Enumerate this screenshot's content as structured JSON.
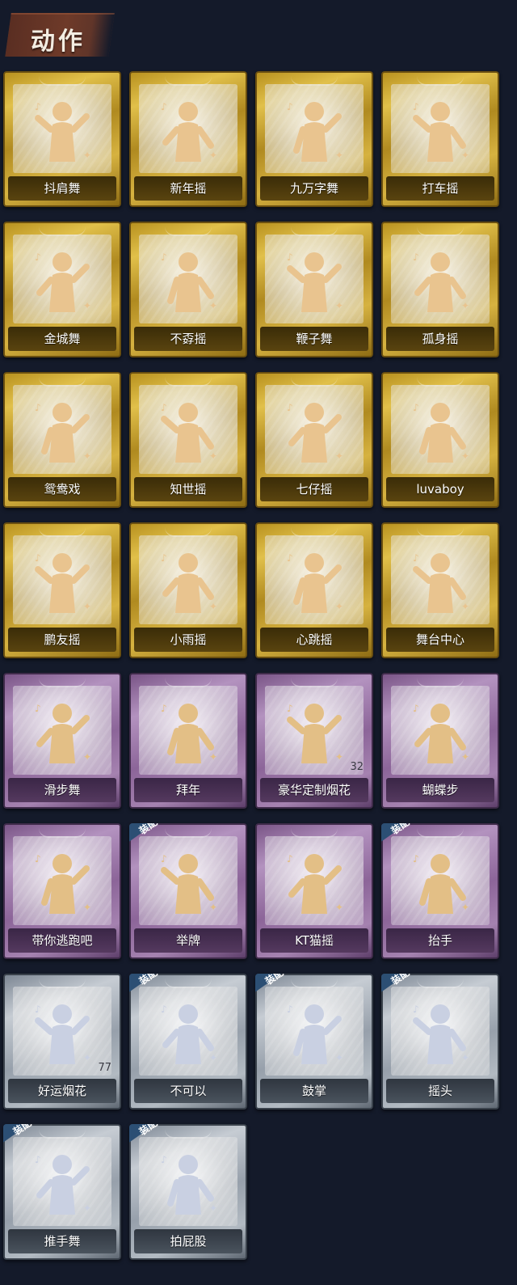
{
  "section": {
    "title": "动作"
  },
  "colors": {
    "gold": "#d6b240",
    "purple": "#a582b0",
    "silver": "#b2bac2",
    "badge": "#2c4f74",
    "background": "#141a2a"
  },
  "items": [
    {
      "label": "抖肩舞",
      "rarity": "gold",
      "icon": "shoulder-dance-icon"
    },
    {
      "label": "新年摇",
      "rarity": "gold",
      "icon": "new-year-dance-icon"
    },
    {
      "label": "九万字舞",
      "rarity": "gold",
      "icon": "swirl-dance-icon"
    },
    {
      "label": "打车摇",
      "rarity": "gold",
      "icon": "taxi-dance-icon"
    },
    {
      "label": "金城舞",
      "rarity": "gold",
      "icon": "wave-dance-icon"
    },
    {
      "label": "不孬摇",
      "rarity": "gold",
      "icon": "raised-arm-dance-icon"
    },
    {
      "label": "鞭子舞",
      "rarity": "gold",
      "icon": "whip-dance-icon"
    },
    {
      "label": "孤身摇",
      "rarity": "gold",
      "icon": "solo-dance-icon"
    },
    {
      "label": "鸳鸯戏",
      "rarity": "gold",
      "icon": "pair-dance-icon"
    },
    {
      "label": "知世摇",
      "rarity": "gold",
      "icon": "arms-out-dance-icon"
    },
    {
      "label": "七仔摇",
      "rarity": "gold",
      "icon": "cross-arm-dance-icon"
    },
    {
      "label": "luvaboy",
      "rarity": "gold",
      "icon": "pointing-dance-icon"
    },
    {
      "label": "鹏友摇",
      "rarity": "gold",
      "icon": "side-arm-dance-icon"
    },
    {
      "label": "小雨摇",
      "rarity": "gold",
      "icon": "rain-dance-icon"
    },
    {
      "label": "心跳摇",
      "rarity": "gold",
      "icon": "heartbeat-dance-icon"
    },
    {
      "label": "舞台中心",
      "rarity": "gold",
      "icon": "center-stage-dance-icon"
    },
    {
      "label": "滑步舞",
      "rarity": "purple",
      "icon": "slide-step-icon"
    },
    {
      "label": "拜年",
      "rarity": "purple",
      "icon": "greeting-bow-icon"
    },
    {
      "label": "豪华定制烟花",
      "rarity": "purple",
      "icon": "fireworks-box-icon",
      "count": "32"
    },
    {
      "label": "蝴蝶步",
      "rarity": "purple",
      "icon": "butterfly-step-icon"
    },
    {
      "label": "带你逃跑吧",
      "rarity": "purple",
      "icon": "run-away-icon"
    },
    {
      "label": "举牌",
      "rarity": "purple",
      "icon": "hold-sign-icon",
      "badge": "装配"
    },
    {
      "label": "KT猫摇",
      "rarity": "purple",
      "icon": "cat-dance-icon"
    },
    {
      "label": "抬手",
      "rarity": "purple",
      "icon": "raise-hand-icon",
      "badge": "装配"
    },
    {
      "label": "好运烟花",
      "rarity": "silver",
      "icon": "lucky-firework-icon",
      "count": "77"
    },
    {
      "label": "不可以",
      "rarity": "silver",
      "icon": "finger-wag-icon",
      "badge": "装配"
    },
    {
      "label": "鼓掌",
      "rarity": "silver",
      "icon": "clap-icon",
      "badge": "装配"
    },
    {
      "label": "摇头",
      "rarity": "silver",
      "icon": "head-shake-icon",
      "badge": "装配"
    },
    {
      "label": "推手舞",
      "rarity": "silver",
      "icon": "push-hands-icon",
      "badge": "装配"
    },
    {
      "label": "拍屁股",
      "rarity": "silver",
      "icon": "butt-slap-icon",
      "badge": "装配"
    }
  ]
}
